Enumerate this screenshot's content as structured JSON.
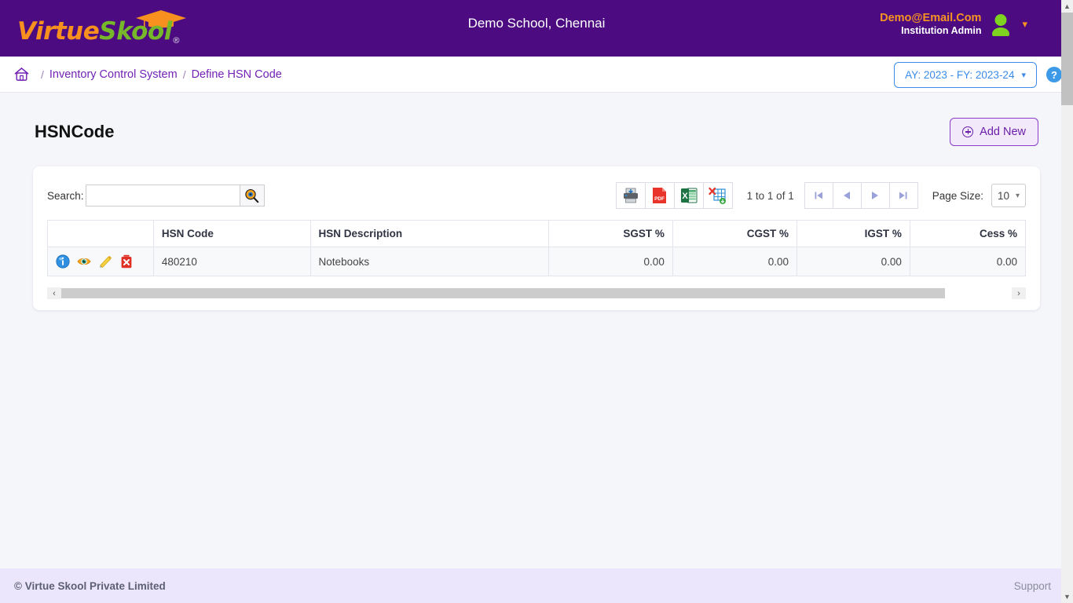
{
  "header": {
    "logo": {
      "part1": "Virtue",
      "part2": "Skool",
      "registered": "®",
      "cap_icon": "graduation-cap-icon"
    },
    "school_title": "Demo School, Chennai",
    "user": {
      "email": "Demo@Email.Com",
      "role": "Institution Admin",
      "avatar_icon": "user-avatar-icon",
      "chevron_icon": "chevron-down-icon"
    },
    "brand_color": "#4c0b80",
    "accent_orange": "#f7901e",
    "accent_green": "#76b82a"
  },
  "breadcrumb": {
    "home_icon": "home-icon",
    "separator": "/",
    "items": [
      {
        "label": "Inventory Control System"
      },
      {
        "label": "Define HSN Code"
      }
    ],
    "academic_year": {
      "label": "AY: 2023 - FY: 2023-24",
      "chevron": "⌄"
    },
    "help_icon_label": "?"
  },
  "content": {
    "page_title": "HSNCode",
    "add_new_label": "Add New"
  },
  "toolbar": {
    "search_label": "Search:",
    "search_value": "",
    "search_placeholder": "",
    "search_button_icon": "magnifier-icon",
    "exports": [
      {
        "name": "print-button",
        "icon": "printer-icon"
      },
      {
        "name": "pdf-export-button",
        "icon": "pdf-icon",
        "label": "PDF"
      },
      {
        "name": "excel-export-button",
        "icon": "excel-icon",
        "label": "X"
      },
      {
        "name": "xml-export-button",
        "icon": "xml-export-icon"
      }
    ],
    "record_count": "1 to 1 of 1",
    "pager": [
      {
        "name": "first-page-button",
        "icon": "first-page-icon"
      },
      {
        "name": "previous-page-button",
        "icon": "previous-page-icon"
      },
      {
        "name": "next-page-button",
        "icon": "next-page-icon"
      },
      {
        "name": "last-page-button",
        "icon": "last-page-icon"
      }
    ],
    "page_size_label": "Page Size:",
    "page_size_value": "10",
    "page_size_chevron": "⌄"
  },
  "table": {
    "columns": [
      {
        "label": "",
        "align": "left"
      },
      {
        "label": "HSN Code",
        "align": "left"
      },
      {
        "label": "HSN Description",
        "align": "left"
      },
      {
        "label": "SGST %",
        "align": "right"
      },
      {
        "label": "CGST %",
        "align": "right"
      },
      {
        "label": "IGST %",
        "align": "right"
      },
      {
        "label": "Cess %",
        "align": "right"
      }
    ],
    "rows": [
      {
        "actions": [
          {
            "name": "info-icon",
            "title": "Info"
          },
          {
            "name": "view-icon",
            "title": "View"
          },
          {
            "name": "edit-icon",
            "title": "Edit"
          },
          {
            "name": "delete-icon",
            "title": "Delete"
          }
        ],
        "hsn_code": "480210",
        "hsn_description": "Notebooks",
        "sgst": "0.00",
        "cgst": "0.00",
        "igst": "0.00",
        "cess": "0.00"
      }
    ],
    "scroll_left_icon": "‹",
    "scroll_right_icon": "›"
  },
  "footer": {
    "copyright": "© Virtue Skool Private Limited",
    "support_label": "Support"
  }
}
